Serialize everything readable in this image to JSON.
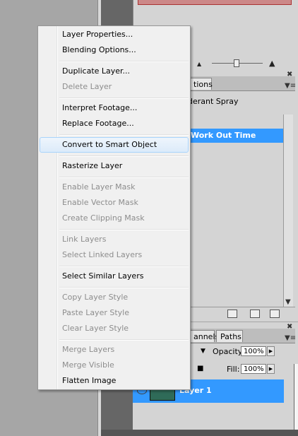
{
  "context_menu": {
    "items": [
      {
        "label": "Layer Properties...",
        "enabled": true
      },
      {
        "label": "Blending Options...",
        "enabled": true
      },
      {
        "label": "Duplicate Layer...",
        "enabled": true
      },
      {
        "label": "Delete Layer",
        "enabled": false
      },
      {
        "label": "Interpret Footage...",
        "enabled": true
      },
      {
        "label": "Replace Footage...",
        "enabled": true
      },
      {
        "label": "Convert to Smart Object",
        "enabled": true,
        "highlighted": true
      },
      {
        "label": "Rasterize Layer",
        "enabled": true
      },
      {
        "label": "Enable Layer Mask",
        "enabled": false
      },
      {
        "label": "Enable Vector Mask",
        "enabled": false
      },
      {
        "label": "Create Clipping Mask",
        "enabled": false
      },
      {
        "label": "Link Layers",
        "enabled": false
      },
      {
        "label": "Select Linked Layers",
        "enabled": false
      },
      {
        "label": "Select Similar Layers",
        "enabled": true
      },
      {
        "label": "Copy Layer Style",
        "enabled": false
      },
      {
        "label": "Paste Layer Style",
        "enabled": false
      },
      {
        "label": "Clear Layer Style",
        "enabled": false
      },
      {
        "label": "Merge Layers",
        "enabled": false
      },
      {
        "label": "Merge Visible",
        "enabled": false
      },
      {
        "label": "Flatten Image",
        "enabled": true
      }
    ]
  },
  "actions_panel": {
    "tab_label": "tions",
    "item_partial": "derant Spray",
    "selected_item": "Work Out Time"
  },
  "layers_panel": {
    "tab_channels": "annels",
    "tab_paths": "Paths",
    "opacity_label": "Opacity:",
    "opacity_value": "100%",
    "fill_label": "Fill:",
    "fill_value": "100%",
    "layer_name": "Layer 1"
  },
  "colors": {
    "selection": "#3399ff",
    "menu_bg": "#f0f0f0",
    "disabled_text": "#8d8d8d"
  }
}
